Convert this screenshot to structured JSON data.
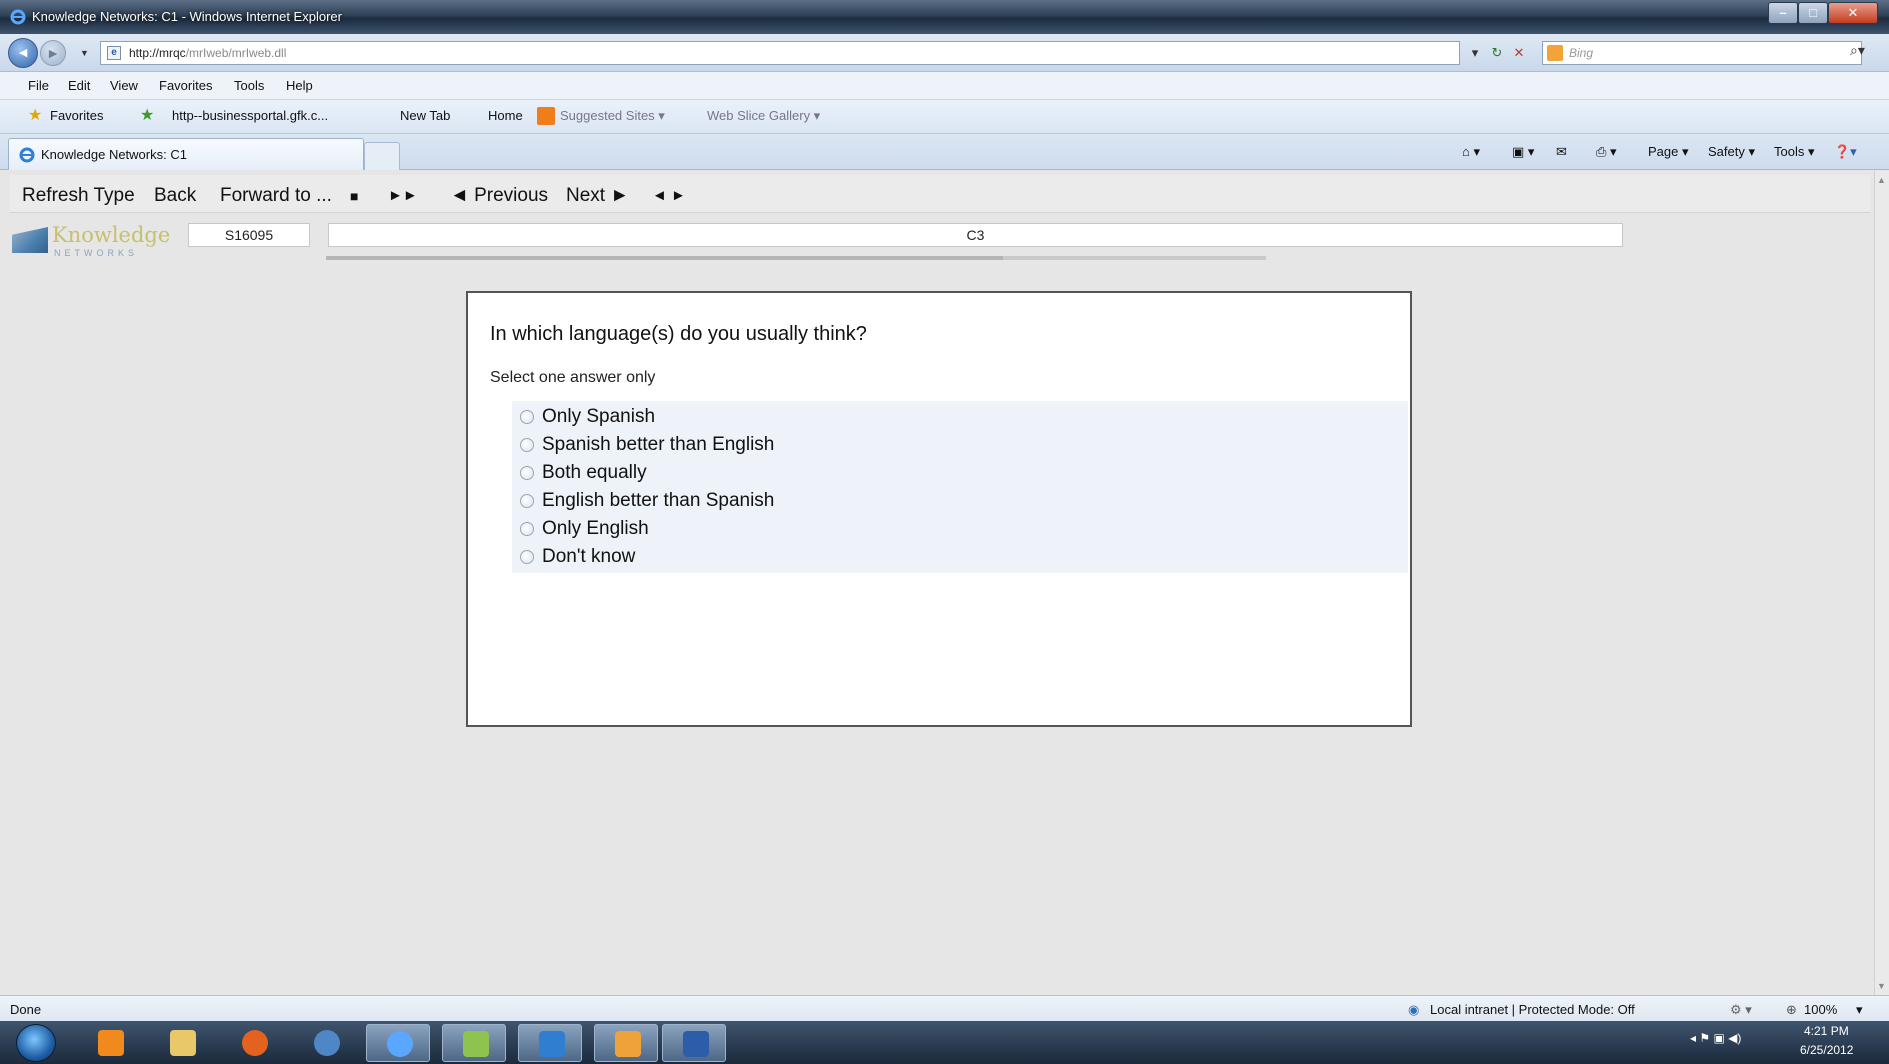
{
  "window": {
    "title": "Knowledge Networks: C1 - Windows Internet Explorer"
  },
  "address_bar": {
    "url_host": "http://mrqc",
    "url_path": "/mrIweb/mrIweb.dll",
    "search_placeholder": "Bing"
  },
  "menu": [
    "File",
    "Edit",
    "View",
    "Favorites",
    "Tools",
    "Help"
  ],
  "favorites_bar": {
    "favorites_label": "Favorites",
    "links": [
      "http--businessportal.gfk.c...",
      "New Tab",
      "Home"
    ],
    "dim_links": [
      "Suggested Sites ▾",
      "Web Slice Gallery ▾"
    ]
  },
  "tab": {
    "title": "Knowledge Networks: C1"
  },
  "command_bar": {
    "page": "Page ▾",
    "safety": "Safety ▾",
    "tools": "Tools ▾"
  },
  "survey_toolbar": {
    "refresh_type": "Refresh Type",
    "back": "Back",
    "forward_to": "Forward to ...",
    "stop": "■",
    "fast_forward": "►►",
    "previous": "◄ Previous",
    "next": "Next ►",
    "first_last": "◄ ►"
  },
  "logo": {
    "word": "Knowledge",
    "sub": "NETWORKS"
  },
  "survey": {
    "respondent_id": "S16095",
    "question_id": "C3",
    "progress": 0.72,
    "question": "In which language(s) do you usually think?",
    "instruction": "Select one answer only",
    "options": [
      "Only Spanish",
      "Spanish better than English",
      "Both equally",
      "English better than Spanish",
      "Only English",
      "Don't know"
    ]
  },
  "status_bar": {
    "status": "Done",
    "zone": "Local intranet | Protected Mode: Off",
    "zoom": "100%"
  },
  "taskbar": {
    "time": "4:21 PM",
    "date": "6/25/2012"
  }
}
